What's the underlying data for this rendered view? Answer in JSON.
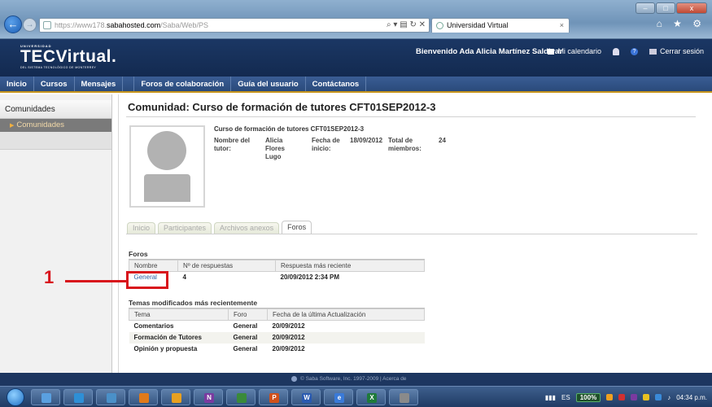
{
  "browser": {
    "url_prefix": "https://www178.",
    "url_domain": "sabahosted.com",
    "url_path": "/Saba/Web/PS",
    "address_tools": "⌕ ▾ ▤ ↻ ✕",
    "tab_title": "Universidad Virtual",
    "tab_close": "×",
    "toolbar_icons": "⌂ ★ ⚙",
    "window_buttons": [
      "–",
      "□",
      "x"
    ]
  },
  "site": {
    "logo_small": "UNIVERSIDAD",
    "logo_big": "TECVirtual.",
    "logo_sub": "DEL SISTEMA TECNOLÓGICO DE MONTERREY",
    "welcome": "Bienvenido Ada Alicia Martínez Saldivar",
    "links": {
      "calendar": "Mi calendario",
      "help": "?",
      "logout": "Cerrar sesión"
    }
  },
  "nav": {
    "items": [
      "Inicio",
      "Cursos",
      "Mensajes",
      "Foros de colaboración",
      "Guía del usuario",
      "Contáctanos"
    ]
  },
  "sidebar": {
    "heading": "Comunidades",
    "item": "Comunidades"
  },
  "community": {
    "title": "Comunidad: Curso de formación de tutores CFT01SEP2012-3",
    "name": "Curso de formación de tutores CFT01SEP2012-3",
    "tutor_label": "Nombre del tutor:",
    "tutor_value": "Alicia Flores Lugo",
    "start_label": "Fecha de inicio:",
    "start_value": "18/09/2012",
    "members_label": "Total de miembros:",
    "members_value": "24"
  },
  "tabs": [
    "Inicio",
    "Participantes",
    "Archivos anexos",
    "Foros"
  ],
  "forums": {
    "heading": "Foros",
    "columns": [
      "Nombre",
      "Nº de respuestas",
      "Respuesta más reciente"
    ],
    "rows": [
      {
        "name": "General",
        "replies": "4",
        "latest": "20/09/2012 2:34 PM"
      }
    ]
  },
  "topics": {
    "heading": "Temas modificados más recientemente",
    "columns": [
      "Tema",
      "Foro",
      "Fecha de la última Actualización"
    ],
    "rows": [
      {
        "topic": "Comentarios",
        "forum": "General",
        "date": "20/09/2012"
      },
      {
        "topic": "Formación de Tutores",
        "forum": "General",
        "date": "20/09/2012"
      },
      {
        "topic": "Opinión y propuesta",
        "forum": "General",
        "date": "20/09/2012"
      }
    ]
  },
  "annotation": {
    "number": "1"
  },
  "footer": {
    "text": "© Saba Software, Inc. 1997-2009 | Acerca de"
  },
  "taskbar": {
    "apps": [
      "",
      "",
      "",
      "",
      "",
      "N",
      "",
      "P",
      "W",
      "e",
      "X",
      ""
    ],
    "lang": "ES",
    "battery": "100%",
    "clock": "04:34 p.m."
  },
  "colors": {
    "accent_red": "#d8141c",
    "header_navy": "#1b3764",
    "nav_blue": "#2a4a7b",
    "link_blue": "#2a5fa6"
  }
}
